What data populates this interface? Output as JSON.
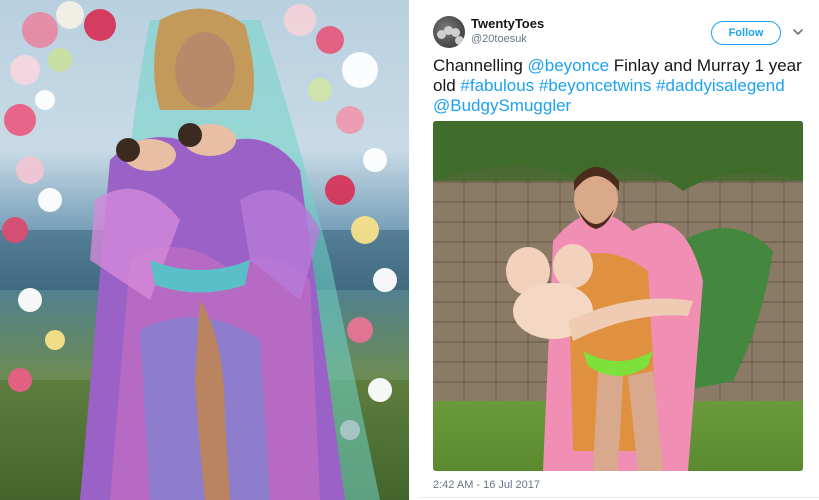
{
  "tweet": {
    "display_name": "TwentyToes",
    "handle": "@20toesuk",
    "follow_label": "Follow",
    "text_parts": [
      {
        "text": "Channelling ",
        "type": "plain"
      },
      {
        "text": "@beyonce",
        "type": "link"
      },
      {
        "text": " Finlay and Murray 1 year old ",
        "type": "plain"
      },
      {
        "text": "#fabulous",
        "type": "link"
      },
      {
        "text": " ",
        "type": "plain"
      },
      {
        "text": "#beyoncetwins",
        "type": "link"
      },
      {
        "text": " ",
        "type": "plain"
      },
      {
        "text": "#daddyisalegend",
        "type": "link"
      },
      {
        "text": " ",
        "type": "plain"
      },
      {
        "text": "@BudgySmuggler",
        "type": "link"
      }
    ],
    "timestamp": "2:42 AM - 16 Jul 2017"
  },
  "colors": {
    "link": "#1da1f2",
    "text": "#14171a",
    "secondary": "#657786"
  },
  "icons": {
    "avatar": "feet-avatar-icon",
    "caret": "chevron-down-icon"
  }
}
